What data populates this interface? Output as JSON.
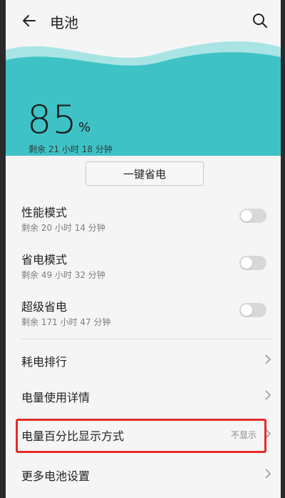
{
  "header": {
    "title": "电池"
  },
  "battery": {
    "percent": "85",
    "percent_sign": "%",
    "remaining": "剩余 21 小时 18 分钟",
    "wave_color": "#3ec2c6"
  },
  "actions": {
    "one_click_save": "一键省电"
  },
  "modes": [
    {
      "title": "性能模式",
      "subtitle": "剩余 20 小时 14 分钟",
      "enabled": false
    },
    {
      "title": "省电模式",
      "subtitle": "剩余 49 小时 32 分钟",
      "enabled": false
    },
    {
      "title": "超级省电",
      "subtitle": "剩余 171 小时 47 分钟",
      "enabled": false
    }
  ],
  "menu": [
    {
      "label": "耗电排行",
      "value": ""
    },
    {
      "label": "电量使用详情",
      "value": ""
    },
    {
      "label": "电量百分比显示方式",
      "value": "不显示"
    },
    {
      "label": "更多电池设置",
      "value": ""
    }
  ],
  "icons": {
    "back": "arrow-left-icon",
    "search": "search-icon",
    "chevron": "chevron-right-icon"
  },
  "colors": {
    "highlight": "#e62a2a",
    "wave": "#3ec2c6"
  }
}
